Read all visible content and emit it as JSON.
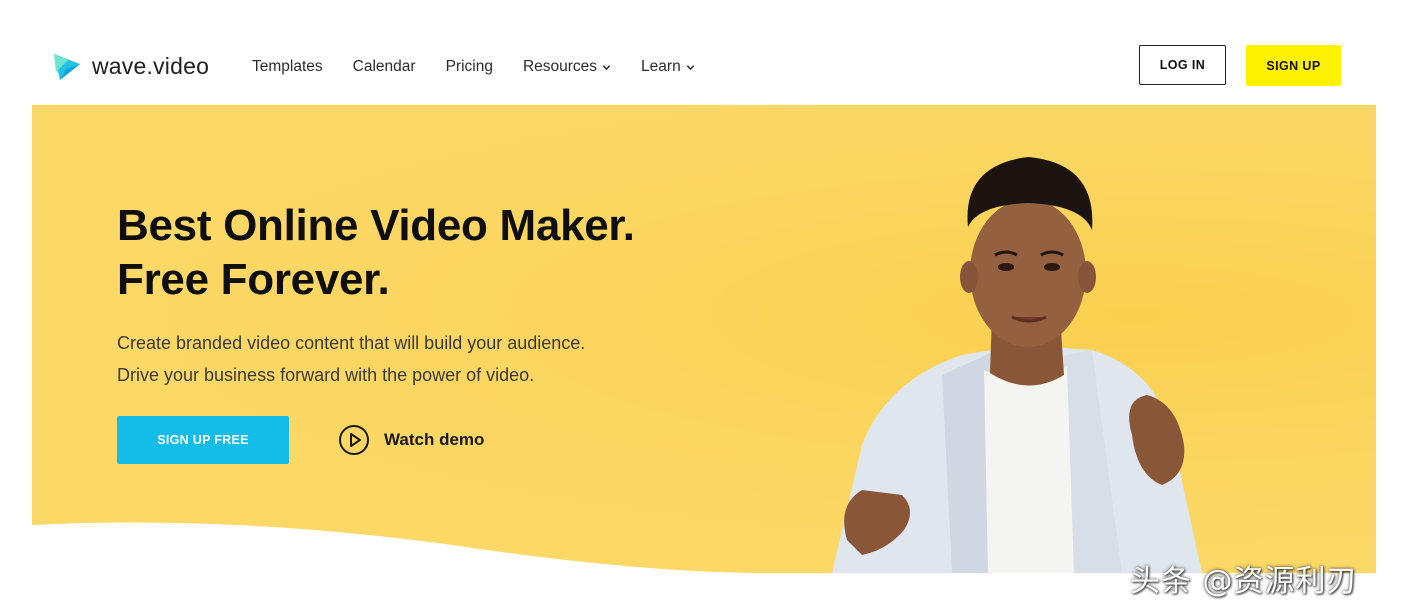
{
  "brand": {
    "name": "wave.video",
    "logo_colors": [
      "#1ec8e8",
      "#5fe0c8"
    ]
  },
  "nav": {
    "items": [
      {
        "label": "Templates",
        "has_dropdown": false
      },
      {
        "label": "Calendar",
        "has_dropdown": false
      },
      {
        "label": "Pricing",
        "has_dropdown": false
      },
      {
        "label": "Resources",
        "has_dropdown": true
      },
      {
        "label": "Learn",
        "has_dropdown": true
      }
    ]
  },
  "auth": {
    "login_label": "LOG IN",
    "signup_label": "SIGN UP"
  },
  "hero": {
    "headline_line1": "Best Online Video Maker.",
    "headline_line2": "Free Forever.",
    "subtext_line1": "Create branded video content that will build your audience.",
    "subtext_line2": "Drive your business forward with the power of video.",
    "cta_primary": "SIGN UP FREE",
    "cta_secondary": "Watch demo",
    "secondary_icon": "play-circle-icon"
  },
  "colors": {
    "hero_bg": "#fcd867",
    "signup_accent": "#fff200",
    "cta_blue": "#14bde8"
  },
  "watermark": "头条 @资源利刃"
}
